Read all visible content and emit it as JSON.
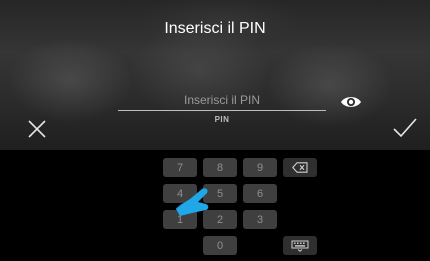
{
  "header": {
    "title": "Inserisci il PIN"
  },
  "pin_field": {
    "placeholder": "Inserisci il PIN",
    "value": "",
    "label": "PIN"
  },
  "keypad": {
    "keys": {
      "k7": "7",
      "k8": "8",
      "k9": "9",
      "k4": "4",
      "k5": "5",
      "k6": "6",
      "k1": "1",
      "k2": "2",
      "k3": "3",
      "k0": "0"
    }
  },
  "icons": {
    "cancel": "close-icon",
    "confirm": "check-icon",
    "visibility": "eye-icon",
    "backspace": "backspace-icon",
    "keyboard": "keyboard-icon",
    "pointer": "hand-pointer-icon"
  },
  "colors": {
    "key_background": "#3f3f3f",
    "key_text": "#8f8f8f",
    "title": "#ffffff",
    "pointer": "#1fa7e8"
  }
}
